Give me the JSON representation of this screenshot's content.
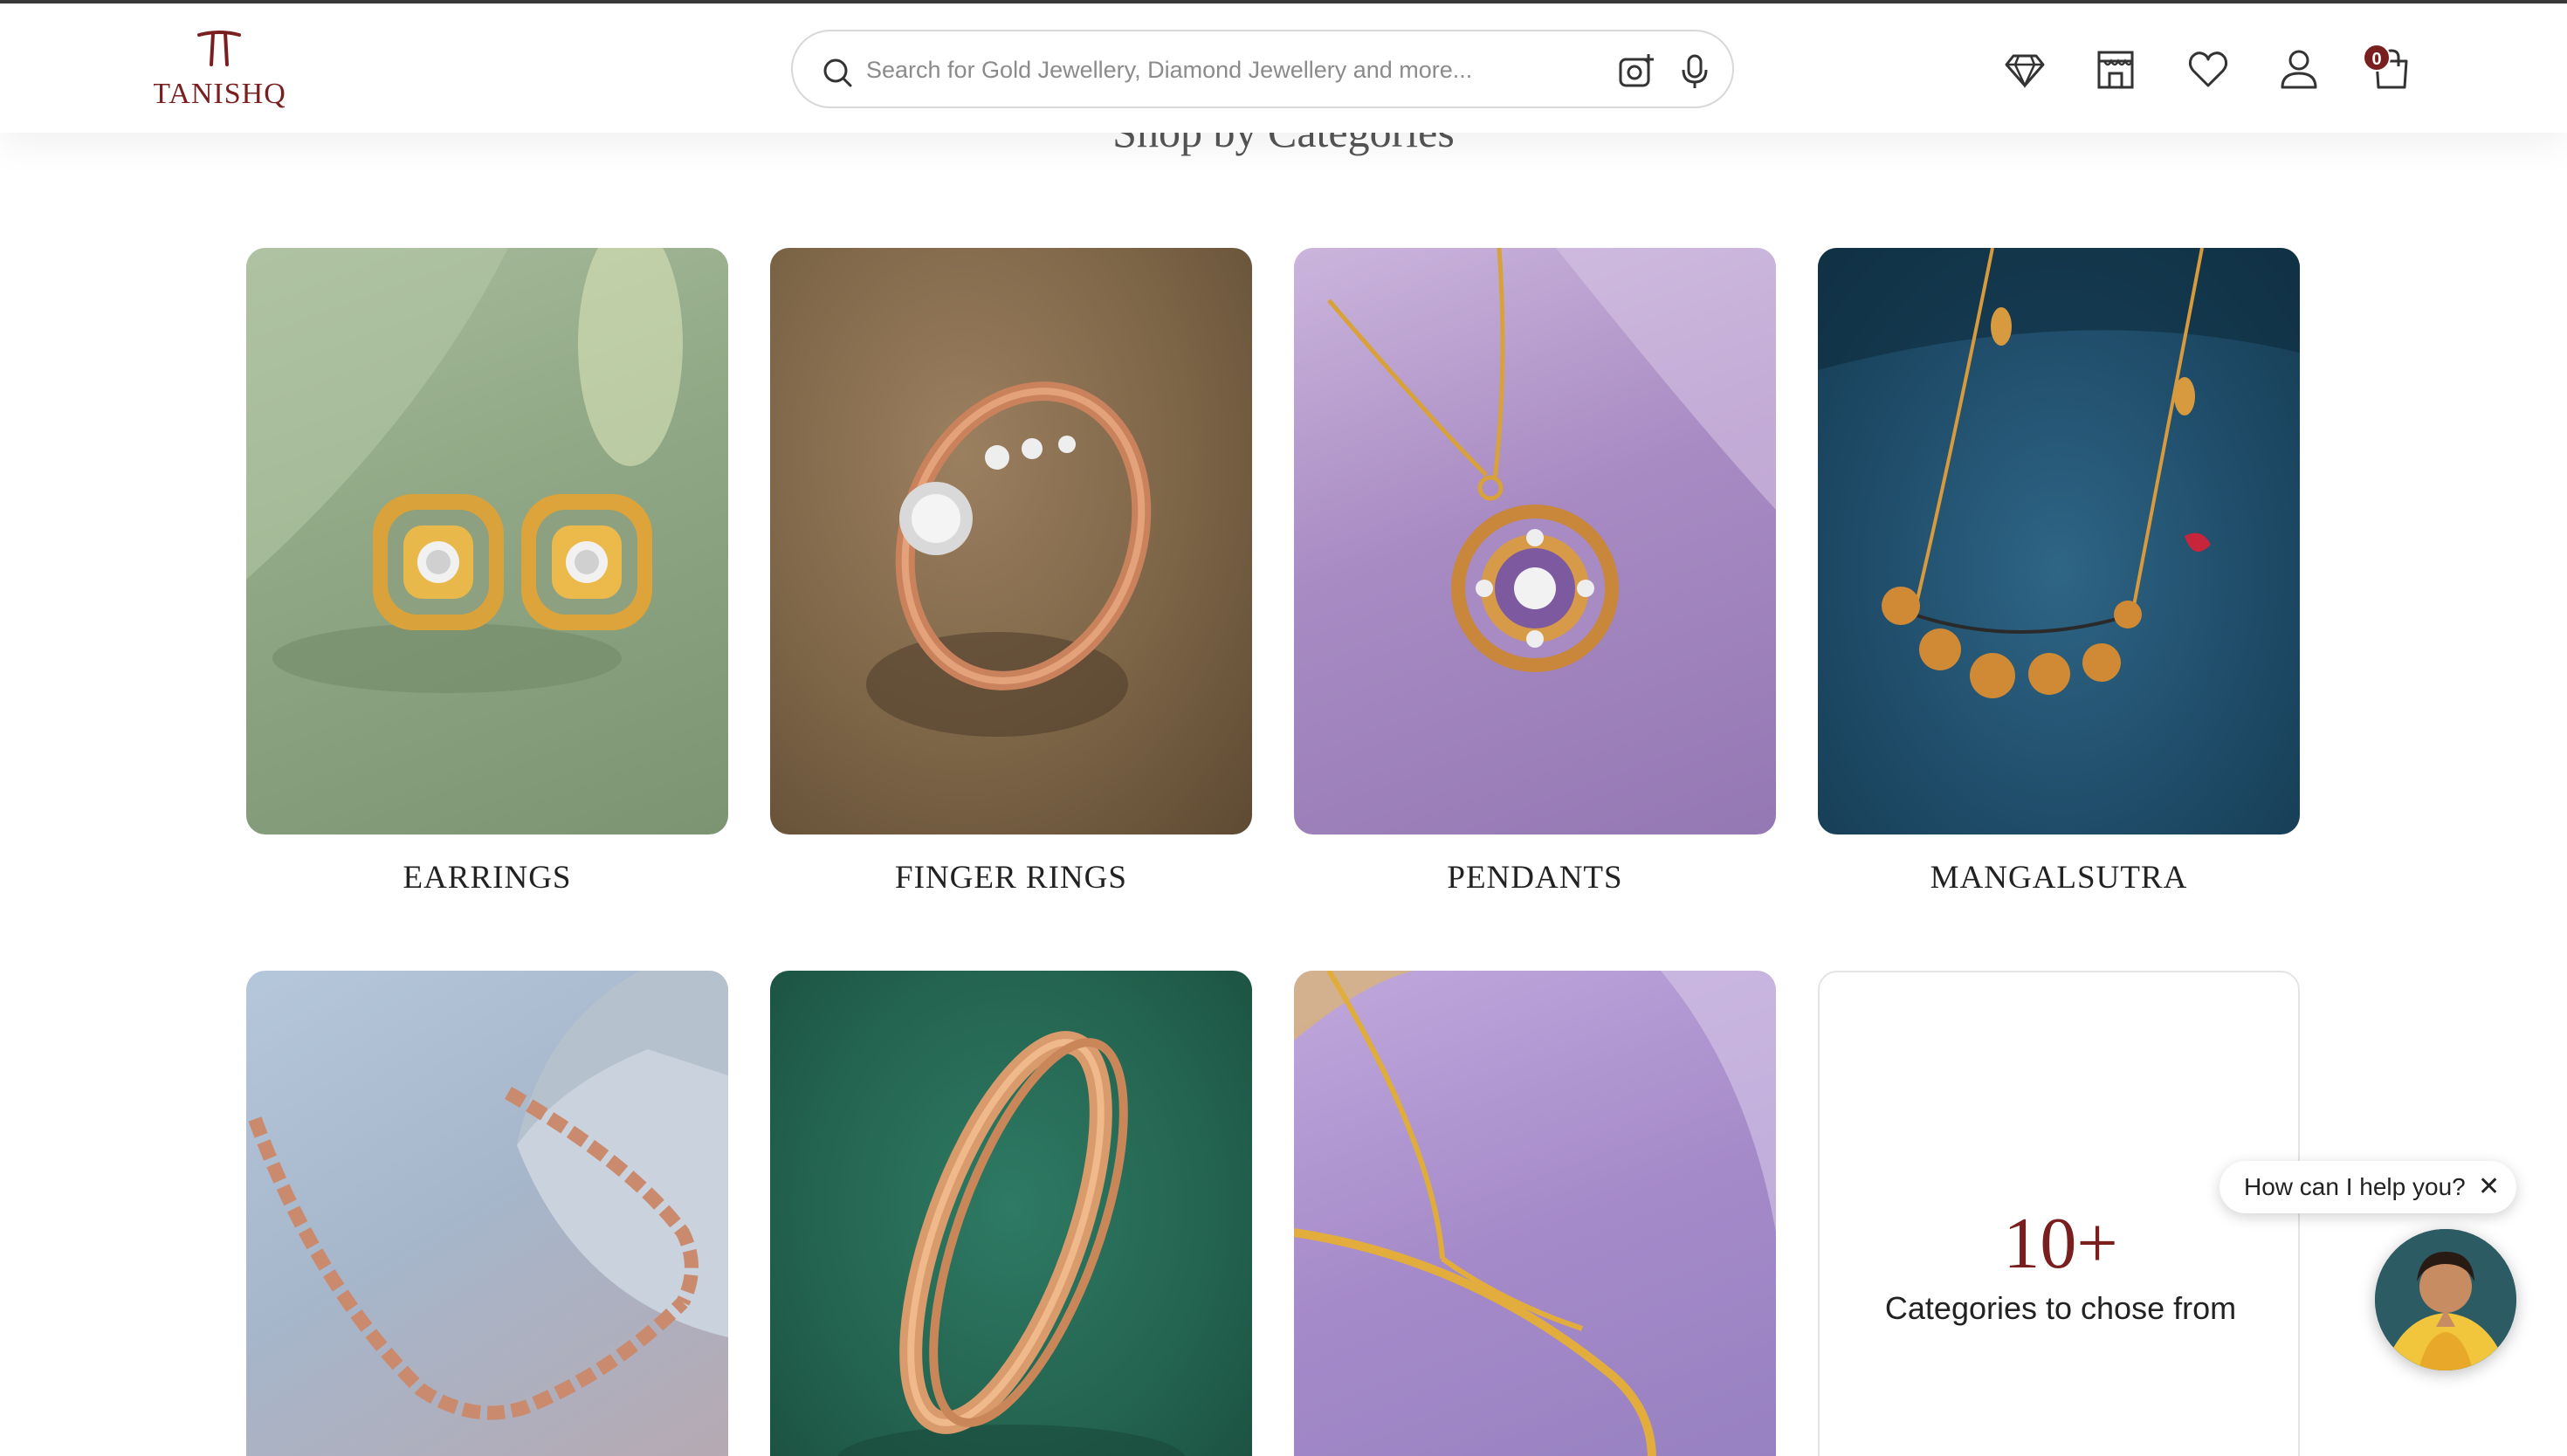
{
  "brand": {
    "logo_text": "TANISHQ",
    "accent_color": "#7a1f1f"
  },
  "search": {
    "placeholder": "Search for Gold Jewellery, Diamond Jewellery and more...",
    "value": "",
    "icons": [
      "search-icon",
      "camera-icon",
      "microphone-icon"
    ]
  },
  "header": {
    "icons": [
      "diamond-icon",
      "store-icon",
      "heart-icon",
      "user-icon",
      "shopping-bag-icon"
    ],
    "cart_count": "0"
  },
  "section": {
    "title": "Shop by Categories"
  },
  "categories": [
    {
      "label": "EARRINGS"
    },
    {
      "label": "FINGER RINGS"
    },
    {
      "label": "PENDANTS"
    },
    {
      "label": "MANGALSUTRA"
    },
    {
      "label": ""
    },
    {
      "label": ""
    },
    {
      "label": ""
    }
  ],
  "more_categories": {
    "count": "10+",
    "text": "Categories to chose from"
  },
  "chat": {
    "prompt": "How can I help you?",
    "close": "✕"
  }
}
